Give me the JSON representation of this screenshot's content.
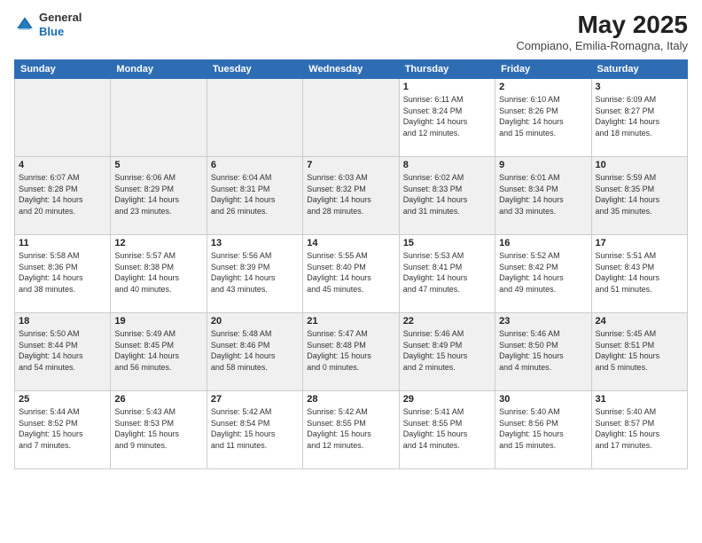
{
  "logo": {
    "general": "General",
    "blue": "Blue"
  },
  "header": {
    "title": "May 2025",
    "location": "Compiano, Emilia-Romagna, Italy"
  },
  "weekdays": [
    "Sunday",
    "Monday",
    "Tuesday",
    "Wednesday",
    "Thursday",
    "Friday",
    "Saturday"
  ],
  "weeks": [
    [
      {
        "day": "",
        "info": ""
      },
      {
        "day": "",
        "info": ""
      },
      {
        "day": "",
        "info": ""
      },
      {
        "day": "",
        "info": ""
      },
      {
        "day": "1",
        "info": "Sunrise: 6:11 AM\nSunset: 8:24 PM\nDaylight: 14 hours\nand 12 minutes."
      },
      {
        "day": "2",
        "info": "Sunrise: 6:10 AM\nSunset: 8:26 PM\nDaylight: 14 hours\nand 15 minutes."
      },
      {
        "day": "3",
        "info": "Sunrise: 6:09 AM\nSunset: 8:27 PM\nDaylight: 14 hours\nand 18 minutes."
      }
    ],
    [
      {
        "day": "4",
        "info": "Sunrise: 6:07 AM\nSunset: 8:28 PM\nDaylight: 14 hours\nand 20 minutes."
      },
      {
        "day": "5",
        "info": "Sunrise: 6:06 AM\nSunset: 8:29 PM\nDaylight: 14 hours\nand 23 minutes."
      },
      {
        "day": "6",
        "info": "Sunrise: 6:04 AM\nSunset: 8:31 PM\nDaylight: 14 hours\nand 26 minutes."
      },
      {
        "day": "7",
        "info": "Sunrise: 6:03 AM\nSunset: 8:32 PM\nDaylight: 14 hours\nand 28 minutes."
      },
      {
        "day": "8",
        "info": "Sunrise: 6:02 AM\nSunset: 8:33 PM\nDaylight: 14 hours\nand 31 minutes."
      },
      {
        "day": "9",
        "info": "Sunrise: 6:01 AM\nSunset: 8:34 PM\nDaylight: 14 hours\nand 33 minutes."
      },
      {
        "day": "10",
        "info": "Sunrise: 5:59 AM\nSunset: 8:35 PM\nDaylight: 14 hours\nand 35 minutes."
      }
    ],
    [
      {
        "day": "11",
        "info": "Sunrise: 5:58 AM\nSunset: 8:36 PM\nDaylight: 14 hours\nand 38 minutes."
      },
      {
        "day": "12",
        "info": "Sunrise: 5:57 AM\nSunset: 8:38 PM\nDaylight: 14 hours\nand 40 minutes."
      },
      {
        "day": "13",
        "info": "Sunrise: 5:56 AM\nSunset: 8:39 PM\nDaylight: 14 hours\nand 43 minutes."
      },
      {
        "day": "14",
        "info": "Sunrise: 5:55 AM\nSunset: 8:40 PM\nDaylight: 14 hours\nand 45 minutes."
      },
      {
        "day": "15",
        "info": "Sunrise: 5:53 AM\nSunset: 8:41 PM\nDaylight: 14 hours\nand 47 minutes."
      },
      {
        "day": "16",
        "info": "Sunrise: 5:52 AM\nSunset: 8:42 PM\nDaylight: 14 hours\nand 49 minutes."
      },
      {
        "day": "17",
        "info": "Sunrise: 5:51 AM\nSunset: 8:43 PM\nDaylight: 14 hours\nand 51 minutes."
      }
    ],
    [
      {
        "day": "18",
        "info": "Sunrise: 5:50 AM\nSunset: 8:44 PM\nDaylight: 14 hours\nand 54 minutes."
      },
      {
        "day": "19",
        "info": "Sunrise: 5:49 AM\nSunset: 8:45 PM\nDaylight: 14 hours\nand 56 minutes."
      },
      {
        "day": "20",
        "info": "Sunrise: 5:48 AM\nSunset: 8:46 PM\nDaylight: 14 hours\nand 58 minutes."
      },
      {
        "day": "21",
        "info": "Sunrise: 5:47 AM\nSunset: 8:48 PM\nDaylight: 15 hours\nand 0 minutes."
      },
      {
        "day": "22",
        "info": "Sunrise: 5:46 AM\nSunset: 8:49 PM\nDaylight: 15 hours\nand 2 minutes."
      },
      {
        "day": "23",
        "info": "Sunrise: 5:46 AM\nSunset: 8:50 PM\nDaylight: 15 hours\nand 4 minutes."
      },
      {
        "day": "24",
        "info": "Sunrise: 5:45 AM\nSunset: 8:51 PM\nDaylight: 15 hours\nand 5 minutes."
      }
    ],
    [
      {
        "day": "25",
        "info": "Sunrise: 5:44 AM\nSunset: 8:52 PM\nDaylight: 15 hours\nand 7 minutes."
      },
      {
        "day": "26",
        "info": "Sunrise: 5:43 AM\nSunset: 8:53 PM\nDaylight: 15 hours\nand 9 minutes."
      },
      {
        "day": "27",
        "info": "Sunrise: 5:42 AM\nSunset: 8:54 PM\nDaylight: 15 hours\nand 11 minutes."
      },
      {
        "day": "28",
        "info": "Sunrise: 5:42 AM\nSunset: 8:55 PM\nDaylight: 15 hours\nand 12 minutes."
      },
      {
        "day": "29",
        "info": "Sunrise: 5:41 AM\nSunset: 8:55 PM\nDaylight: 15 hours\nand 14 minutes."
      },
      {
        "day": "30",
        "info": "Sunrise: 5:40 AM\nSunset: 8:56 PM\nDaylight: 15 hours\nand 15 minutes."
      },
      {
        "day": "31",
        "info": "Sunrise: 5:40 AM\nSunset: 8:57 PM\nDaylight: 15 hours\nand 17 minutes."
      }
    ]
  ]
}
